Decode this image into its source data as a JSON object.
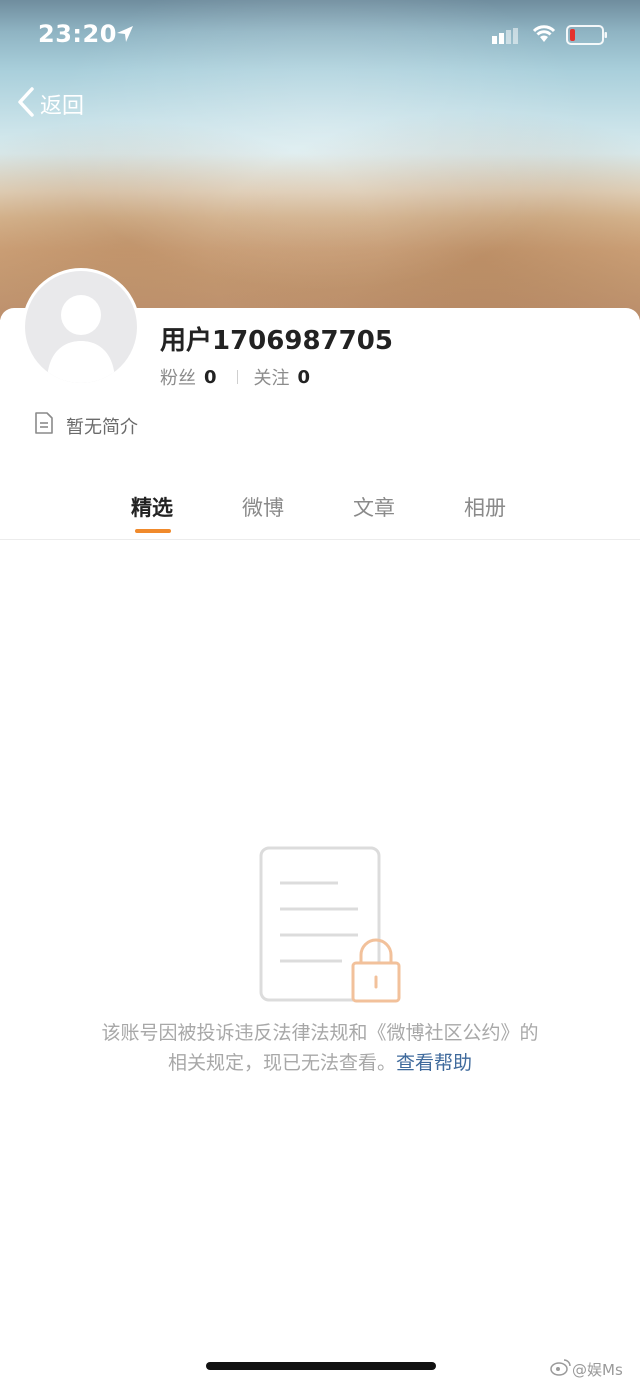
{
  "status_bar": {
    "time": "23:20"
  },
  "nav": {
    "back_label": "返回"
  },
  "profile": {
    "username": "用户1706987705",
    "followers_label": "粉丝",
    "followers_count": "0",
    "following_label": "关注",
    "following_count": "0",
    "bio": "暂无简介"
  },
  "tabs": [
    {
      "label": "精选",
      "active": true
    },
    {
      "label": "微博",
      "active": false
    },
    {
      "label": "文章",
      "active": false
    },
    {
      "label": "相册",
      "active": false
    }
  ],
  "blocked": {
    "line1": "该账号因被投诉违反法律法规和《微博社区公约》的",
    "line2": "相关规定，现已无法查看。",
    "help_link": "查看帮助"
  },
  "watermark": {
    "text": "@娱Ms"
  },
  "colors": {
    "accent": "#f08a2c",
    "link": "#3f6a9c",
    "muted_text": "#a8a8a8"
  }
}
